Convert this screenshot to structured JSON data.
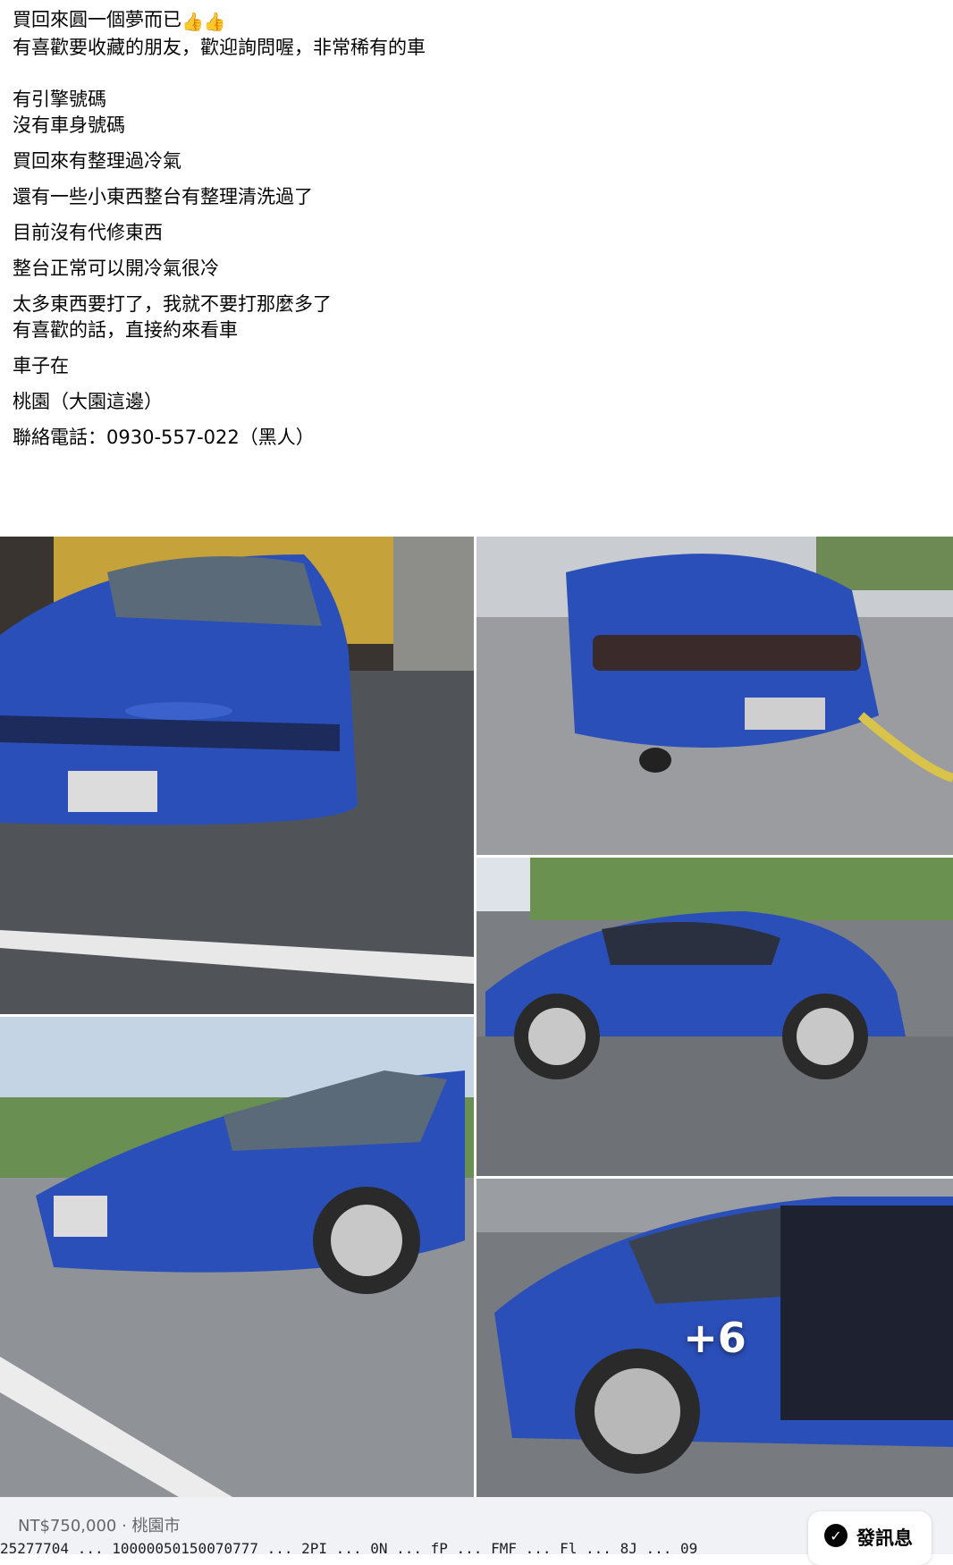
{
  "post": {
    "lines": [
      "買回來圓一個夢而已",
      "有喜歡要收藏的朋友，歡迎詢問喔，非常稀有的車",
      "有引擎號碼",
      "沒有車身號碼",
      "買回來有整理過冷氣",
      "還有一些小東西整台有整理清洗過了",
      "目前沒有代修東西",
      "整台正常可以開冷氣很冷",
      "太多東西要打了，我就不要打那麼多了",
      "有喜歡的話，直接約來看車",
      "車子在",
      "桃園（大園這邊）",
      "聯絡電話：0930-557-022（黑人）"
    ],
    "emoji": "👍👍"
  },
  "gallery": {
    "more_count": "+6"
  },
  "footer": {
    "price_location": "NT$750,000 · 桃園市",
    "send_label": "發訊息",
    "send_icon": "messenger-icon",
    "url_fragment": "25277704 ... 10000050150070777 ... 2PI ... 0N ... fP ... FMF ... Fl ... 8J ... 09"
  },
  "colors": {
    "car_blue": "#2b4fb8",
    "text": "#050505",
    "muted": "#65676b",
    "footer_bg": "#f0f2f5"
  }
}
